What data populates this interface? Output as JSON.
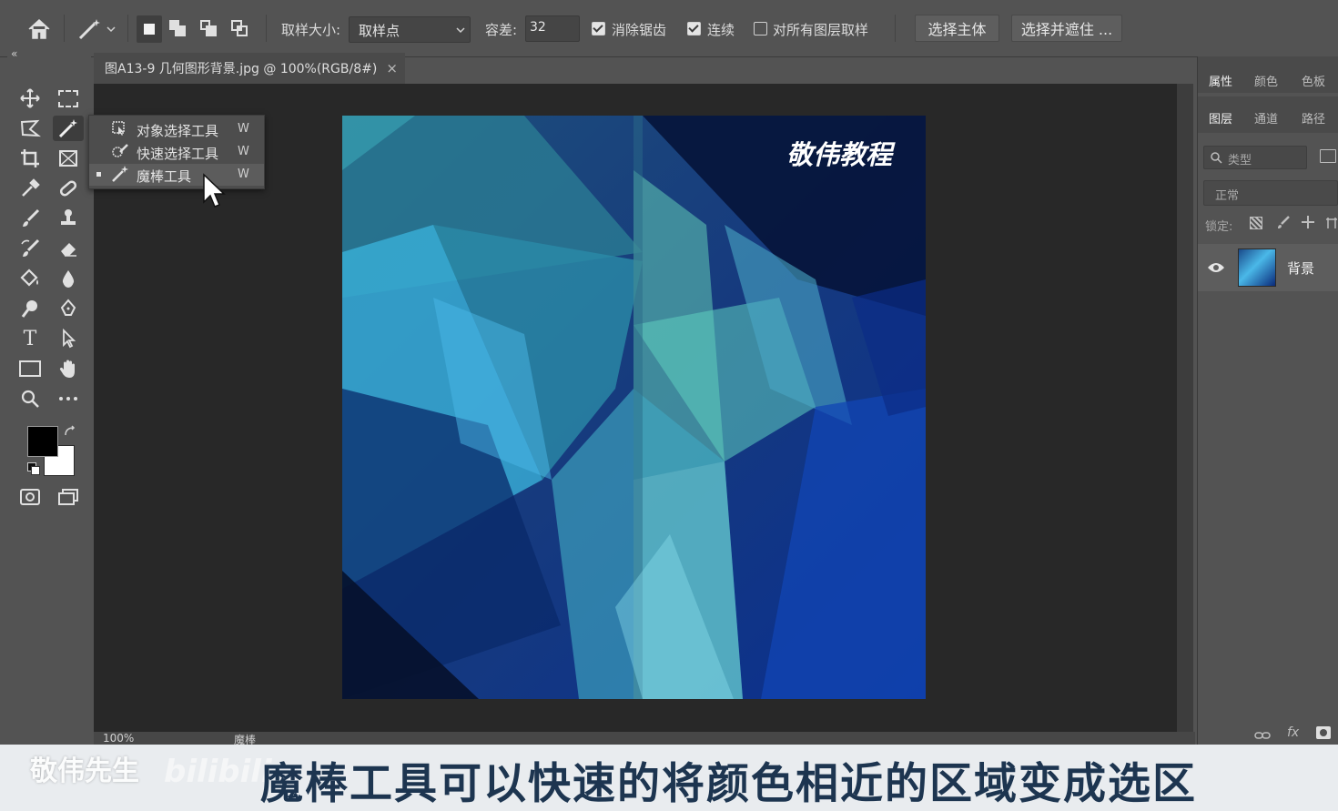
{
  "optbar": {
    "sample_size_label": "取样大小:",
    "sample_size_value": "取样点",
    "tolerance_label": "容差:",
    "tolerance_value": "32",
    "anti_alias_label": "消除锯齿",
    "contiguous_label": "连续",
    "all_layers_label": "对所有图层取样",
    "select_subject_label": "选择主体",
    "select_mask_label": "选择并遮住 ..."
  },
  "document": {
    "tab_title": "图A13-9 几何图形背景.jpg @ 100%(RGB/8#)",
    "close_glyph": "×",
    "image_watermark": "敬伟教程",
    "zoom": "100%",
    "status_tool": "魔棒"
  },
  "flyout": {
    "items": [
      {
        "label": "对象选择工具",
        "key": "W"
      },
      {
        "label": "快速选择工具",
        "key": "W"
      },
      {
        "label": "魔棒工具",
        "key": "W"
      }
    ]
  },
  "toolbar": {
    "collapse_glyph": "«"
  },
  "panels": {
    "tabs_top": [
      "属性",
      "颜色",
      "色板"
    ],
    "tabs_layers": [
      "图层",
      "通道",
      "路径"
    ],
    "filter_placeholder": "类型",
    "blend_mode": "正常",
    "lock_label": "锁定:",
    "layer_name": "背景"
  },
  "caption": {
    "text": "魔棒工具可以快速的将颜色相近的区域变成选区",
    "watermark": "敬伟先生",
    "watermark2": "bilibili"
  },
  "colors": {
    "foreground": "#000000",
    "background": "#ffffff"
  }
}
